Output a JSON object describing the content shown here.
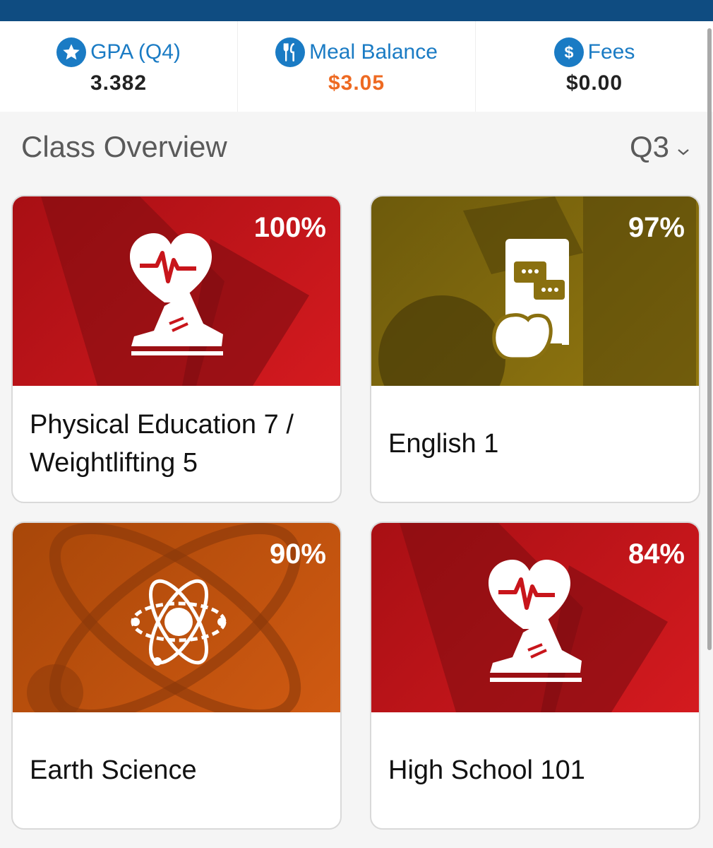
{
  "stats": [
    {
      "label": "GPA (Q4)",
      "value": "3.382",
      "icon": "star-icon",
      "value_color": "#222222"
    },
    {
      "label": "Meal Balance",
      "value": "$3.05",
      "icon": "fork-knife-icon",
      "value_color": "#ee6a22"
    },
    {
      "label": "Fees",
      "value": "$0.00",
      "icon": "dollar-icon",
      "value_color": "#222222"
    }
  ],
  "overview": {
    "title": "Class Overview",
    "quarter": "Q3"
  },
  "classes": [
    {
      "name": "Physical Education 7 / Weightlifting 5",
      "grade": "100%",
      "icon": "heart-shoe-icon",
      "color": "#c8151b"
    },
    {
      "name": "English 1",
      "grade": "97%",
      "icon": "book-apple-icon",
      "color": "#8a7010"
    },
    {
      "name": "Earth Science",
      "grade": "90%",
      "icon": "atom-icon",
      "color": "#c9540f"
    },
    {
      "name": "High School 101",
      "grade": "84%",
      "icon": "heart-shoe-icon",
      "color": "#c8151b"
    }
  ],
  "colors": {
    "header": "#0f4c81",
    "accent": "#1a7bc4",
    "meal": "#ee6a22"
  }
}
